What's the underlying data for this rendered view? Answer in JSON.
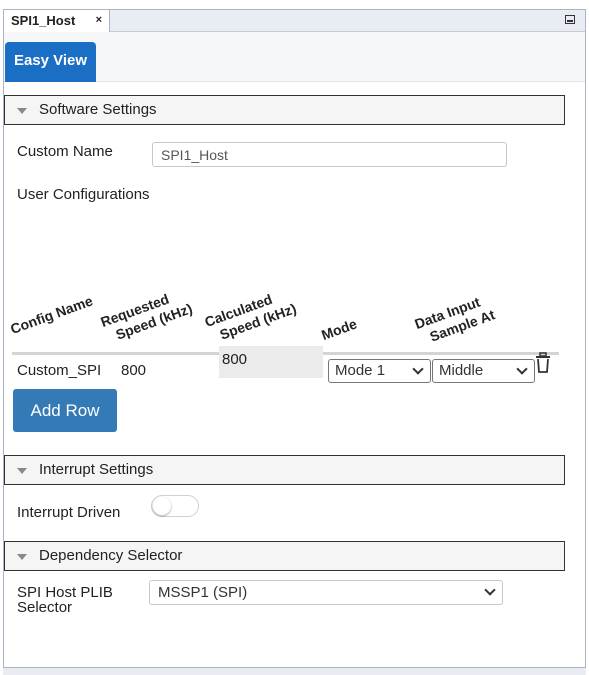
{
  "window": {
    "tab_title": "SPI1_Host",
    "tab_close": "×"
  },
  "tabs": {
    "easy_view": "Easy View"
  },
  "software_settings": {
    "header": "Software Settings",
    "custom_name_label": "Custom Name",
    "custom_name_value": "SPI1_Host",
    "user_configurations_label": "User Configurations",
    "columns": {
      "config_name": "Config Name",
      "requested_1": "Requested",
      "requested_2": "Speed (kHz)",
      "calculated_1": "Calculated",
      "calculated_2": "Speed (kHz)",
      "mode": "Mode",
      "data_input_1": "Data Input",
      "data_input_2": "Sample At"
    },
    "rows": [
      {
        "config_name": "Custom_SPI",
        "requested_speed": "800",
        "calculated_speed": "800",
        "mode": "Mode 1",
        "sample_at": "Middle"
      }
    ],
    "add_row": "Add Row"
  },
  "interrupt_settings": {
    "header": "Interrupt Settings",
    "interrupt_driven_label": "Interrupt Driven",
    "interrupt_driven_on": false
  },
  "dependency_selector": {
    "header": "Dependency Selector",
    "plib_label_1": "SPI Host PLIB",
    "plib_label_2": "Selector",
    "plib_value": "MSSP1 (SPI)"
  },
  "colors": {
    "accent": "#1a6fc4",
    "button": "#337ab7"
  },
  "icons": {
    "collapse": "triangle-down-icon",
    "delete": "trash-icon",
    "minimize": "minimize-icon"
  }
}
